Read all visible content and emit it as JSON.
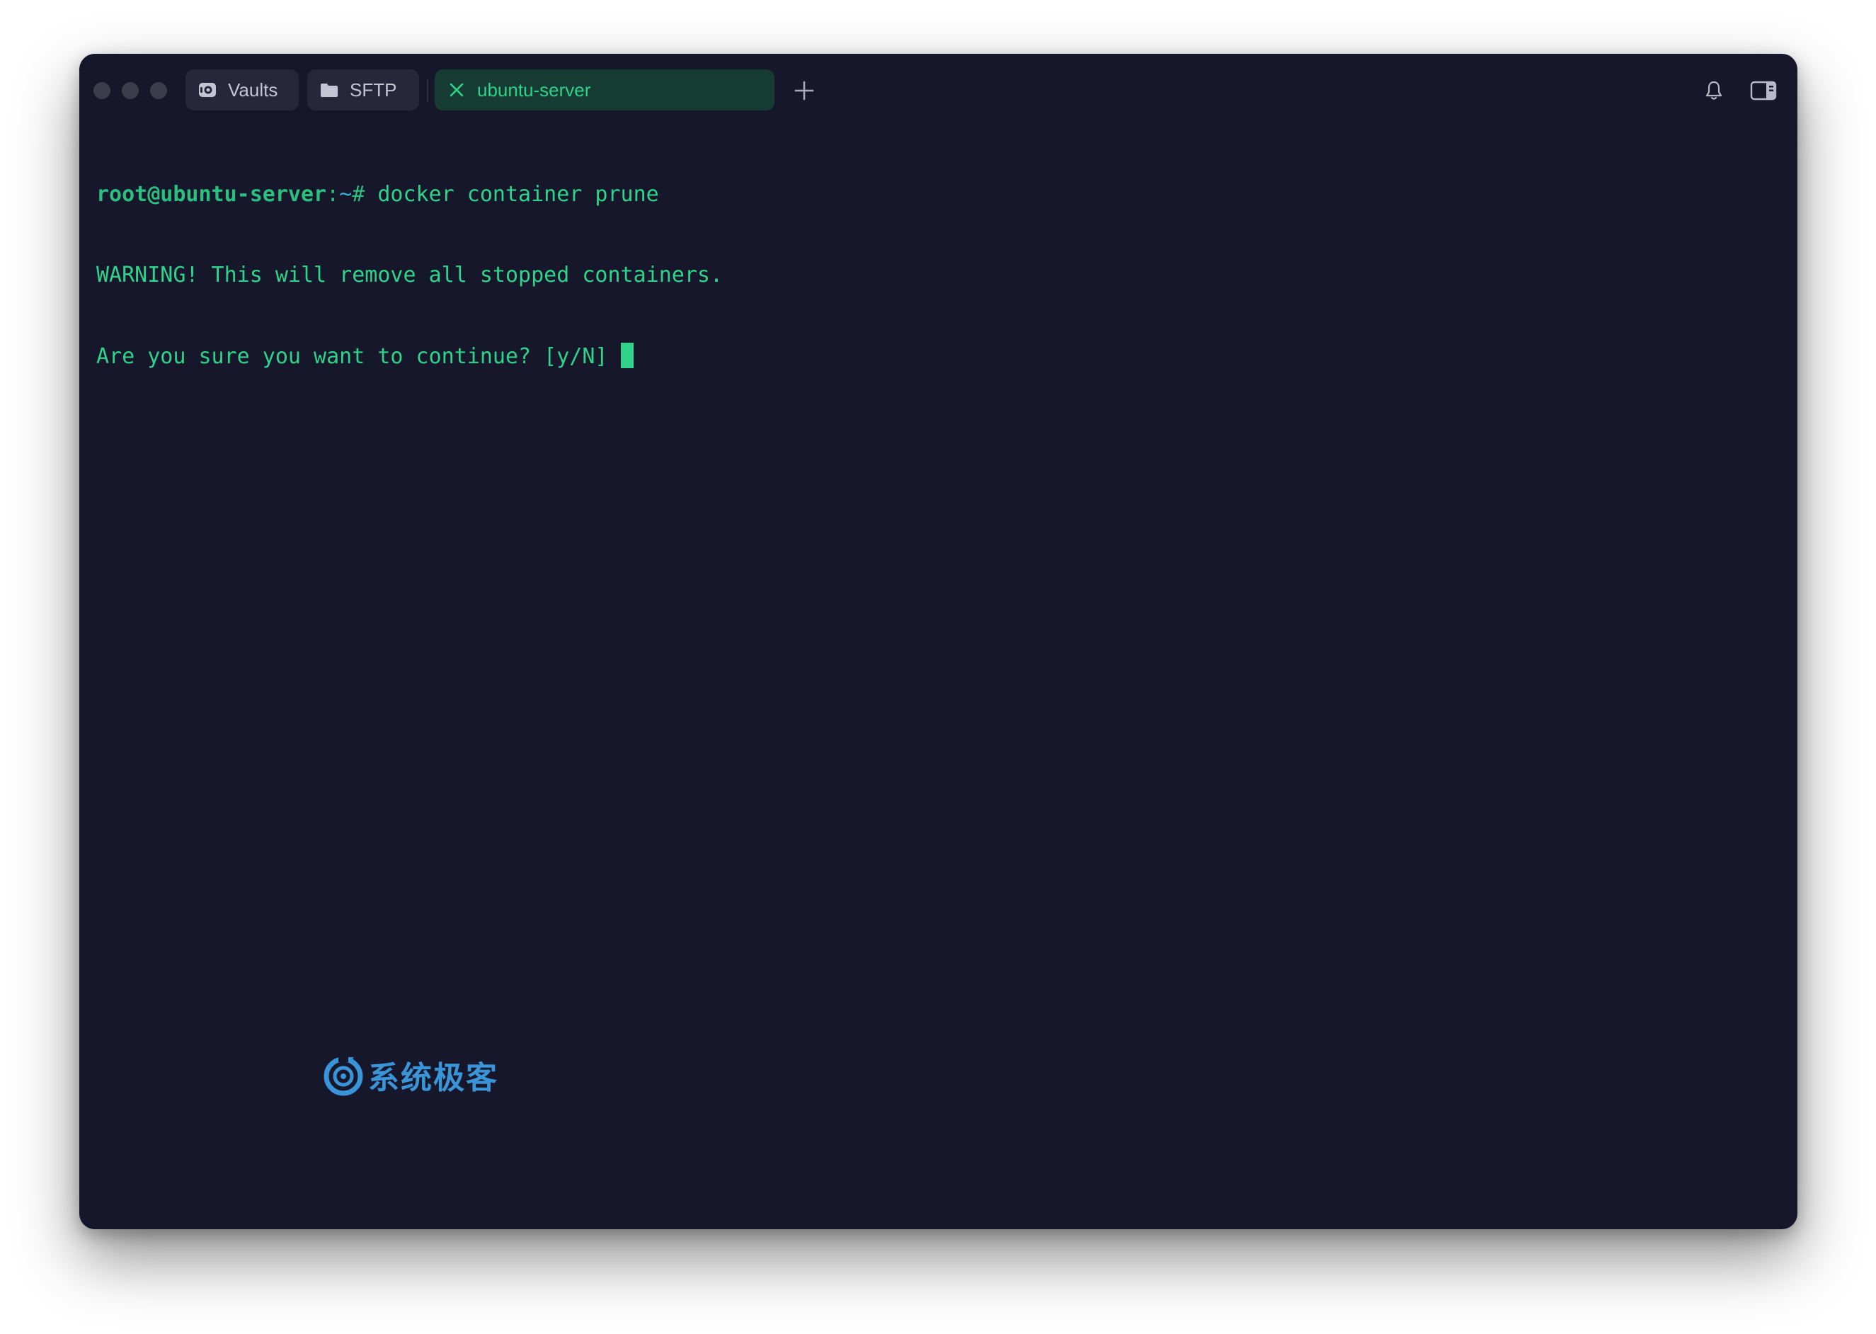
{
  "window": {
    "traffic_lights": [
      "close",
      "minimize",
      "zoom"
    ]
  },
  "tabs": [
    {
      "label": "Vaults",
      "icon": "vault-icon"
    },
    {
      "label": "SFTP",
      "icon": "folder-icon"
    },
    {
      "label": "ubuntu-server",
      "icon": "close-icon",
      "active": true
    }
  ],
  "toolbar": {
    "new_tab_icon": "plus-icon",
    "notifications_icon": "bell-icon",
    "panel_icon": "sidebar-panel-icon"
  },
  "terminal": {
    "prompt_user": "root@ubuntu-server",
    "prompt_sep": ":",
    "prompt_path": "~",
    "prompt_symbol": "# ",
    "command": "docker container prune",
    "output_line_1": "WARNING! This will remove all stopped containers.",
    "output_line_2": "Are you sure you want to continue? [y/N] "
  },
  "watermark": {
    "text": "系统极客"
  },
  "colors": {
    "background": "#16172a",
    "accent_green": "#2fd38a",
    "active_tab_bg": "#163b33",
    "watermark_blue": "#3a95d8"
  }
}
